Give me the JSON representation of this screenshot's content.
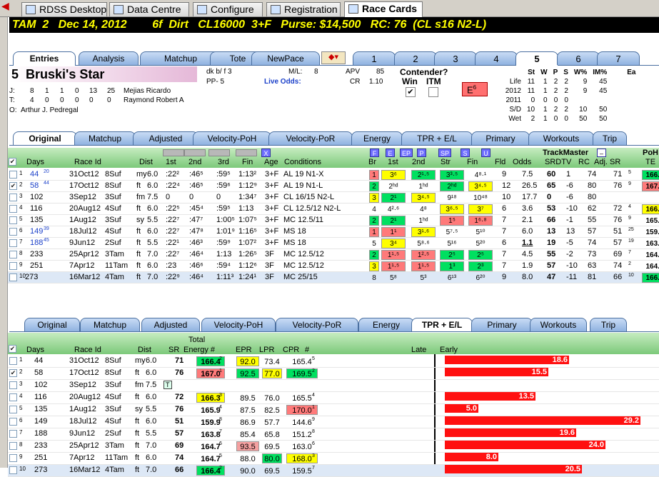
{
  "app_tabs": [
    {
      "label": "RDSS Desktop"
    },
    {
      "label": "Data Centre"
    },
    {
      "label": "Configure"
    },
    {
      "label": "Registration"
    },
    {
      "label": "Race Cards"
    }
  ],
  "header": "TAM  2   Dec 14, 2012        6f  Dirt   CL16000  3+F   Purse: $14,500   RC: 76  (CL s16 N2-L)",
  "upper_tabs": [
    "Entries",
    "Analysis",
    "Matchup",
    "Tote",
    "NewPace"
  ],
  "race_tabs": [
    "1",
    "2",
    "3",
    "4",
    "5",
    "6",
    "7"
  ],
  "horse": {
    "pp": "5",
    "name": "Bruski's Star",
    "color": "dk b/ f 3",
    "pp_label": "PP- 5",
    "ml_label": "M/L:",
    "ml": "8",
    "live_odds": "Live Odds:",
    "apv_label": "APV",
    "apv": "85",
    "cr_label": "CR",
    "cr": "1.10",
    "contender": "Contender?",
    "win": "Win",
    "itm": "ITM",
    "e_badge": "E",
    "e_num": "6",
    "j_label": "J:",
    "j_stats": [
      "8",
      "1",
      "1",
      "0",
      "13",
      "25"
    ],
    "jockey": "Mejias Ricardo",
    "t_label": "T:",
    "t_stats": [
      "4",
      "0",
      "0",
      "0",
      "0",
      "0"
    ],
    "trainer": "Raymond Robert A",
    "o_label": "O:",
    "owner": "Arthur J. Pedregal"
  },
  "record": {
    "headers": [
      "",
      "St",
      "W",
      "P",
      "S",
      "W%",
      "IM%",
      "Ea"
    ],
    "rows": [
      [
        "Life",
        "11",
        "1",
        "2",
        "2",
        "9",
        "45"
      ],
      [
        "2012",
        "11",
        "1",
        "2",
        "2",
        "9",
        "45"
      ],
      [
        "2011",
        "0",
        "0",
        "0",
        "0",
        "",
        ""
      ],
      [
        "S/D",
        "10",
        "1",
        "2",
        "2",
        "10",
        "50"
      ],
      [
        "Wet",
        "2",
        "1",
        "0",
        "0",
        "50",
        "50"
      ]
    ]
  },
  "mid_tabs": [
    "Original",
    "Matchup",
    "Adjusted",
    "Velocity-PoH",
    "Velocity-PoR",
    "Energy",
    "TPR + E/L",
    "Primary",
    "Workouts",
    "Trip"
  ],
  "pp_headers": {
    "days": "Days",
    "race_id": "Race Id",
    "dist": "Dist",
    "c1": "1st",
    "c2": "2nd",
    "c3": "3rd",
    "fin": "Fin",
    "age": "Age",
    "cond": "Conditions",
    "br": "Br",
    "f1": "1st",
    "f2": "2nd",
    "str": "Str",
    "ffin": "Fin",
    "fld": "Fld",
    "odds": "Odds",
    "srdtv": "SRDTV",
    "rc": "RC",
    "adjsr": "Adj. SR",
    "tm": "TrackMaster",
    "poh": "PoH",
    "te": "TE",
    "x": "X",
    "fh": [
      "F",
      "E",
      "EP",
      "P",
      "SP",
      "S",
      "U"
    ]
  },
  "pp_rows": [
    {
      "n": "1",
      "days": "44",
      "sup": "20",
      "date": "31Oct12",
      "race": "8Suf",
      "cond": "my",
      "dist": "6.0",
      "t1": ":22²",
      "t2": ":46⁵",
      "t3": ":59⁵",
      "fin": "1:13²",
      "age": "3+F",
      "cls": "AL 19 N1-X",
      "br": "1",
      "f1": "3⁶",
      "f2": "2¹·⁵",
      "str": "3³·⁵",
      "ffin": "4⁸·¹",
      "fld": "9",
      "odds": "7.5",
      "sr": "60",
      "dtv": "1",
      "rc": "74",
      "adj": "71",
      "adjs": "5",
      "te": "166.4"
    },
    {
      "n": "2",
      "days": "58",
      "sup": "44",
      "date": "17Oct12",
      "race": "8Suf",
      "cond": "ft",
      "dist": "6.0",
      "t1": ":22⁴",
      "t2": ":46⁵",
      "t3": ":59⁶",
      "fin": "1:12⁹",
      "age": "3+F",
      "cls": "AL 19 N1-L",
      "br": "2",
      "f1": "2ʰᵈ",
      "f2": "1ʰᵈ",
      "str": "2ʰᵈ",
      "ffin": "3⁴·⁵",
      "fld": "12",
      "odds": "26.5",
      "sr": "65",
      "dtv": "-6",
      "rc": "80",
      "adj": "76",
      "adjs": "9",
      "te": "167.0"
    },
    {
      "n": "3",
      "days": "102",
      "sup": "",
      "date": "3Sep12",
      "race": "3Suf",
      "cond": "fm",
      "dist": "7.5",
      "t1": "0",
      "t2": "0",
      "t3": "0",
      "fin": "1:34⁷",
      "age": "3+F",
      "cls": "CL 16/15 N2-L",
      "br": "3",
      "f1": "2¹",
      "f2": "3⁴·⁵",
      "str": "9¹⁸",
      "ffin": "10⁴⁸",
      "fld": "10",
      "odds": "17.7",
      "sr": "0",
      "dtv": "-6",
      "rc": "80",
      "adj": "",
      "adjs": "",
      "te": ""
    },
    {
      "n": "4",
      "days": "116",
      "sup": "",
      "date": "20Aug12",
      "race": "4Suf",
      "cond": "ft",
      "dist": "6.0",
      "t1": ":22⁵",
      "t2": ":45⁴",
      "t3": ":59⁵",
      "fin": "1:13",
      "age": "3+F",
      "cls": "CL 12.5/12 N2-L",
      "br": "4",
      "f1": "4²·⁶",
      "f2": "4⁸",
      "str": "3⁶·⁵",
      "ffin": "3⁷",
      "fld": "6",
      "odds": "3.6",
      "sr": "53",
      "dtv": "-10",
      "rc": "62",
      "adj": "72",
      "adjs": "4",
      "te": "166.3"
    },
    {
      "n": "5",
      "days": "135",
      "sup": "",
      "date": "1Aug12",
      "race": "3Suf",
      "cond": "sy",
      "dist": "5.5",
      "t1": ":22⁷",
      "t2": ":47⁷",
      "t3": "1:00⁵",
      "fin": "1:07⁵",
      "age": "3+F",
      "cls": "MC 12.5/11",
      "br": "2",
      "f1": "2¹",
      "f2": "1ʰᵈ",
      "str": "1⁵",
      "ffin": "1⁶·⁸",
      "fld": "7",
      "odds": "2.1",
      "sr": "66",
      "dtv": "-1",
      "rc": "55",
      "adj": "76",
      "adjs": "9",
      "te": "165.9"
    },
    {
      "n": "6",
      "days": "149",
      "sup": "39",
      "date": "18Jul12",
      "race": "4Suf",
      "cond": "ft",
      "dist": "6.0",
      "t1": ":22⁷",
      "t2": ":47⁸",
      "t3": "1:01⁹",
      "fin": "1:16⁵",
      "age": "3+F",
      "cls": "MS 18",
      "br": "1",
      "f1": "1¹",
      "f2": "3¹·⁶",
      "str": "5⁷·⁵",
      "ffin": "5¹⁰",
      "fld": "7",
      "odds": "6.0",
      "sr": "13",
      "dtv": "13",
      "rc": "57",
      "adj": "51",
      "adjs": "25",
      "te": "159.9"
    },
    {
      "n": "7",
      "days": "188",
      "sup": "45",
      "date": "9Jun12",
      "race": "2Suf",
      "cond": "ft",
      "dist": "5.5",
      "t1": ":22¹",
      "t2": ":46³",
      "t3": ":59⁹",
      "fin": "1:07²",
      "age": "3+F",
      "cls": "MS 18",
      "br": "5",
      "f1": "3⁴",
      "f2": "5⁸·⁶",
      "str": "5¹⁶",
      "ffin": "5²⁰",
      "fld": "6",
      "odds": "1.1",
      "sr": "19",
      "dtv": "-5",
      "rc": "74",
      "adj": "57",
      "adjs": "19",
      "te": "163.8"
    },
    {
      "n": "8",
      "days": "233",
      "sup": "",
      "date": "25Apr12",
      "race": "3Tam",
      "cond": "ft",
      "dist": "7.0",
      "t1": ":22⁷",
      "t2": ":46⁴",
      "t3": "1:13",
      "fin": "1:26⁵",
      "age": "3F",
      "cls": "MC 12.5/12",
      "br": "2",
      "f1": "1¹·⁵",
      "f2": "1²·⁵",
      "str": "2⁵",
      "ffin": "2⁵",
      "fld": "7",
      "odds": "4.5",
      "sr": "55",
      "dtv": "-2",
      "rc": "73",
      "adj": "69",
      "adjs": "7",
      "te": "164.7"
    },
    {
      "n": "9",
      "days": "251",
      "sup": "",
      "date": "7Apr12",
      "race": "11Tam",
      "cond": "ft",
      "dist": "6.0",
      "t1": ":23",
      "t2": ":46⁶",
      "t3": ":59⁴",
      "fin": "1:12⁶",
      "age": "3F",
      "cls": "MC 12.5/12",
      "br": "3",
      "f1": "1¹·⁵",
      "f2": "1¹·⁵",
      "str": "1³",
      "ffin": "2³",
      "fld": "7",
      "odds": "1.9",
      "sr": "57",
      "dtv": "-10",
      "rc": "63",
      "adj": "74",
      "adjs": "2",
      "te": "164.7"
    },
    {
      "n": "10",
      "days": "273",
      "sup": "",
      "date": "16Mar12",
      "race": "4Tam",
      "cond": "ft",
      "dist": "7.0",
      "t1": ":22⁹",
      "t2": ":46⁴",
      "t3": "1:11³",
      "fin": "1:24¹",
      "age": "3F",
      "cls": "MC 25/15",
      "br": "8",
      "f1": "5⁸",
      "f2": "5³",
      "str": "6¹³",
      "ffin": "6²⁰",
      "fld": "9",
      "odds": "8.0",
      "sr": "47",
      "dtv": "-11",
      "rc": "81",
      "adj": "66",
      "adjs": "10",
      "te": "166.4"
    }
  ],
  "lower_headers": {
    "days": "Days",
    "race_id": "Race Id",
    "dist": "Dist",
    "sr": "SR",
    "total": "Total",
    "energy": "Energy #",
    "epr": "EPR",
    "lpr": "LPR",
    "cpr": "CPR",
    "hash": "#",
    "late": "Late",
    "early": "Early"
  },
  "lower_rows": [
    {
      "n": "1",
      "days": "44",
      "date": "31Oct12",
      "race": "8Suf",
      "cond": "my",
      "dist": "6.0",
      "sr": "71",
      "en": "166.4",
      "enr": "2",
      "epr": "92.0",
      "lpr": "73.4",
      "cpr": "165.4",
      "cr": "5",
      "early": 18.6
    },
    {
      "n": "2",
      "days": "58",
      "date": "17Oct12",
      "race": "8Suf",
      "cond": "ft",
      "dist": "6.0",
      "sr": "76",
      "en": "167.0",
      "enr": "1",
      "epr": "92.5",
      "lpr": "77.0",
      "cpr": "169.5",
      "cr": "2",
      "early": 15.5
    },
    {
      "n": "3",
      "days": "102",
      "date": "3Sep12",
      "race": "3Suf",
      "cond": "fm",
      "dist": "7.5",
      "sr": "",
      "en": "",
      "enr": "",
      "epr": "",
      "lpr": "",
      "cpr": "",
      "cr": "",
      "early": null
    },
    {
      "n": "4",
      "days": "116",
      "date": "20Aug12",
      "race": "4Suf",
      "cond": "ft",
      "dist": "6.0",
      "sr": "72",
      "en": "166.3",
      "enr": "3",
      "epr": "89.5",
      "lpr": "76.0",
      "cpr": "165.5",
      "cr": "4",
      "early": 13.5
    },
    {
      "n": "5",
      "days": "135",
      "date": "1Aug12",
      "race": "3Suf",
      "cond": "sy",
      "dist": "5.5",
      "sr": "76",
      "en": "165.9",
      "enr": "4",
      "epr": "87.5",
      "lpr": "82.5",
      "cpr": "170.0",
      "cr": "1",
      "early": 5.0
    },
    {
      "n": "6",
      "days": "149",
      "date": "18Jul12",
      "race": "4Suf",
      "cond": "ft",
      "dist": "6.0",
      "sr": "51",
      "en": "159.9",
      "enr": "8",
      "epr": "86.9",
      "lpr": "57.7",
      "cpr": "144.6",
      "cr": "9",
      "early": 29.2
    },
    {
      "n": "7",
      "days": "188",
      "date": "9Jun12",
      "race": "2Suf",
      "cond": "ft",
      "dist": "5.5",
      "sr": "57",
      "en": "163.8",
      "enr": "7",
      "epr": "85.4",
      "lpr": "65.8",
      "cpr": "151.2",
      "cr": "8",
      "early": 19.6
    },
    {
      "n": "8",
      "days": "233",
      "date": "25Apr12",
      "race": "3Tam",
      "cond": "ft",
      "dist": "7.0",
      "sr": "69",
      "en": "164.7",
      "enr": "6",
      "epr": "93.5",
      "lpr": "69.5",
      "cpr": "163.0",
      "cr": "6",
      "early": 24.0
    },
    {
      "n": "9",
      "days": "251",
      "date": "7Apr12",
      "race": "11Tam",
      "cond": "ft",
      "dist": "6.0",
      "sr": "74",
      "en": "164.7",
      "enr": "5",
      "epr": "88.0",
      "lpr": "80.0",
      "cpr": "168.0",
      "cr": "3",
      "early": 8.0
    },
    {
      "n": "10",
      "days": "273",
      "date": "16Mar12",
      "race": "4Tam",
      "cond": "ft",
      "dist": "7.0",
      "sr": "66",
      "en": "166.4",
      "enr": "2",
      "epr": "90.0",
      "lpr": "69.5",
      "cpr": "159.5",
      "cr": "7",
      "early": 20.5
    }
  ],
  "colors": {
    "header_bg": "#000000",
    "header_fg": "#ffff00",
    "bar": "#ff1010",
    "green_hdr": "#7cc97a"
  }
}
